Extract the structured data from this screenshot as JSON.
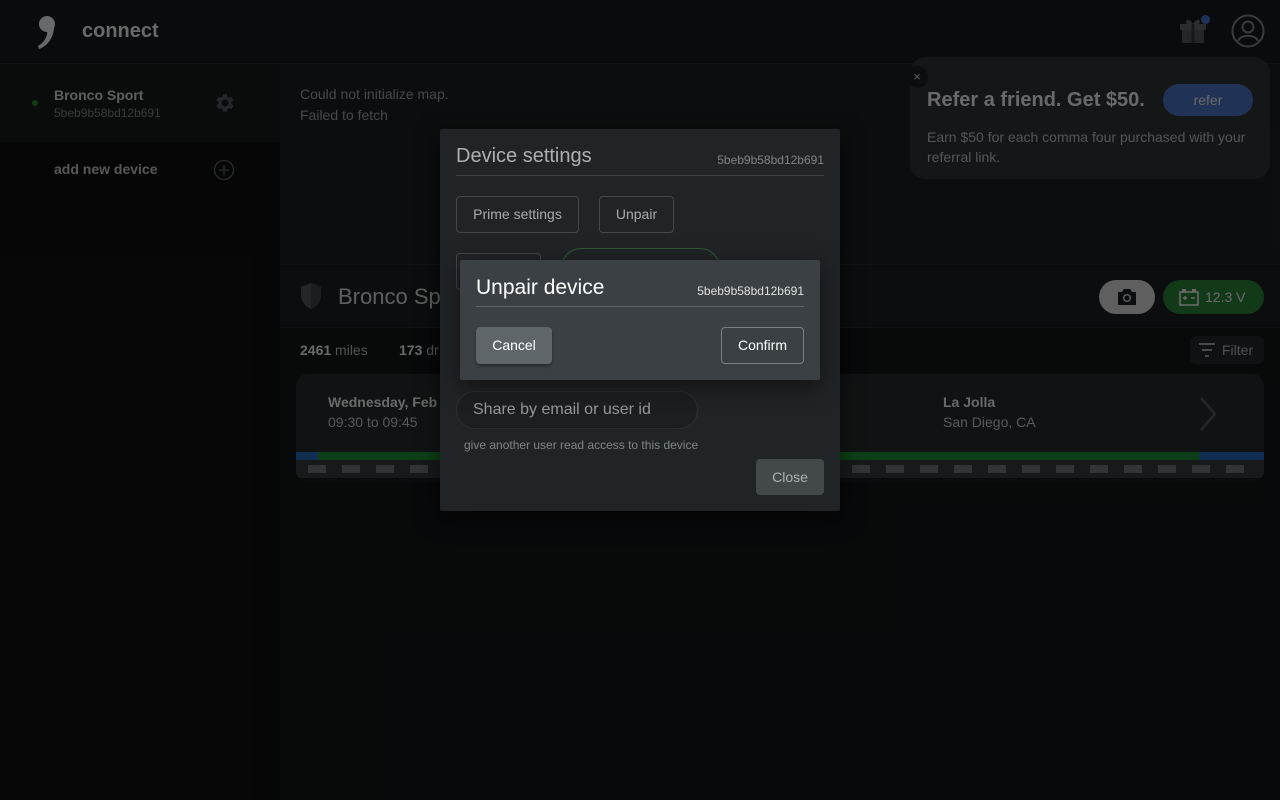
{
  "header": {
    "app_title": "connect",
    "icons": {
      "logo": "comma-logo-icon",
      "gift": "gift-icon",
      "account": "account-circle-icon"
    },
    "notification_color": "#4f7ad1"
  },
  "sidebar": {
    "devices": [
      {
        "name": "Bronco Sport",
        "dongle_id": "5beb9b58bd12b691",
        "online": true,
        "icon": "gear-icon"
      }
    ],
    "add_device_label": "add new device",
    "add_icon": "plus-circle-icon"
  },
  "map": {
    "error_line1": "Could not initialize map.",
    "error_line2": "Failed to fetch"
  },
  "referral": {
    "title": "Refer a friend. Get $50.",
    "button_label": "refer",
    "description": "Earn $50 for each comma four purchased with your referral link.",
    "close_label": "×"
  },
  "vehicle": {
    "name": "Bronco Sport",
    "battery": "12.3 V",
    "battery_color": "#2f8a3c",
    "icons": {
      "shield": "shield-icon",
      "camera": "camera-icon",
      "battery": "car-battery-icon"
    }
  },
  "stats": {
    "miles_value": "2461",
    "miles_unit": "miles",
    "drives_value": "173",
    "drives_unit": "dr"
  },
  "filter_label": "Filter",
  "drive": {
    "date": "Wednesday, Feb",
    "time": "09:30 to 09:45",
    "destination": "La Jolla",
    "city": "San Diego, CA"
  },
  "settings_dialog": {
    "title": "Device settings",
    "dongle_id": "5beb9b58bd12b691",
    "prime_label": "Prime settings",
    "unpair_label": "Unpair",
    "share_placeholder": "Share by email or user id",
    "share_hint": "give another user read access to this device",
    "close_label": "Close"
  },
  "unpair_dialog": {
    "title": "Unpair device",
    "dongle_id": "5beb9b58bd12b691",
    "cancel_label": "Cancel",
    "confirm_label": "Confirm"
  }
}
